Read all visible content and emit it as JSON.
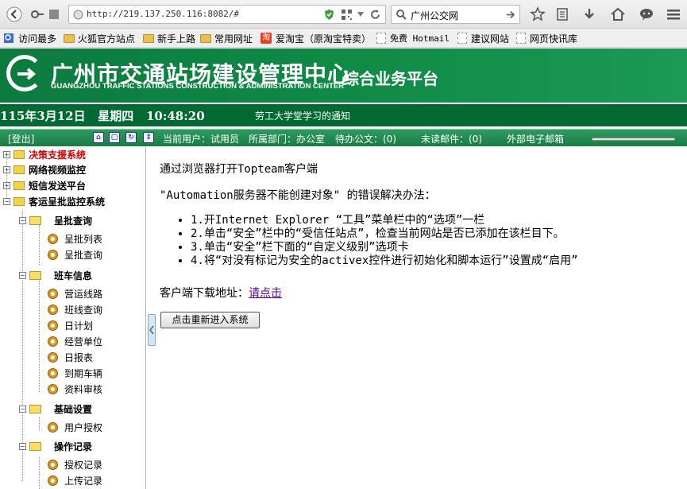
{
  "browser": {
    "url": "http://219.137.250.116:8082/#",
    "search_value": "广州公交网"
  },
  "bookmarks": [
    "访问最多",
    "火狐官方站点",
    "新手上路",
    "常用网址",
    "爱淘宝（原淘宝特卖）",
    "免费 Hotmail",
    "建议网站",
    "网页快讯库"
  ],
  "header": {
    "title": "广州市交通站场建设管理中心",
    "subtitle": "GUANGZHOU TRAFFIC STATIONS CONSTRUCTION & ADMINISTRATION CENTER",
    "platform": "综合业务平台"
  },
  "datebar": {
    "date": "115年3月12日   星期四   10:48:20",
    "notice": "劳工大学堂学习的通知"
  },
  "infobar": {
    "logout": "[登出]",
    "current_user": "当前用户：试用员",
    "department": "所属部门：办公室",
    "pending": "待办公文：(0)",
    "unread": "未读邮件：(0)",
    "external_mail": "外部电子邮箱"
  },
  "sidebar": {
    "top": [
      "决策支援系统",
      "网络视频监控",
      "短信发送平台",
      "客运呈批监控系统"
    ],
    "g1": "呈批查询",
    "g1_items": [
      "呈批列表",
      "呈批查询"
    ],
    "g2": "班车信息",
    "g2_items": [
      "营运线路",
      "班线查询",
      "日计划",
      "经营单位",
      "日报表",
      "到期车辆",
      "资料审核"
    ],
    "g3": "基础设置",
    "g3_items": [
      "用户授权"
    ],
    "g4": "操作记录",
    "g4_items": [
      "授权记录",
      "上传记录"
    ]
  },
  "main": {
    "heading": "通过浏览器打开Topteam客户端",
    "error_title": "\"Automation服务器不能创建对象\" 的错误解决办法：",
    "steps": [
      "1.开Internet Explorer “工具”菜单栏中的“选项”一栏",
      "2.单击“安全”栏中的“受信任站点”，检查当前网站是否已添加在该栏目下。",
      "3.单击“安全”栏下面的“自定义级别”选项卡",
      "4.将“对没有标记为安全的activex控件进行初始化和脚本运行”设置成“启用”"
    ],
    "download_label": "客户端下载地址：",
    "download_link": "请点击",
    "reenter_button": "点击重新进入系统"
  }
}
